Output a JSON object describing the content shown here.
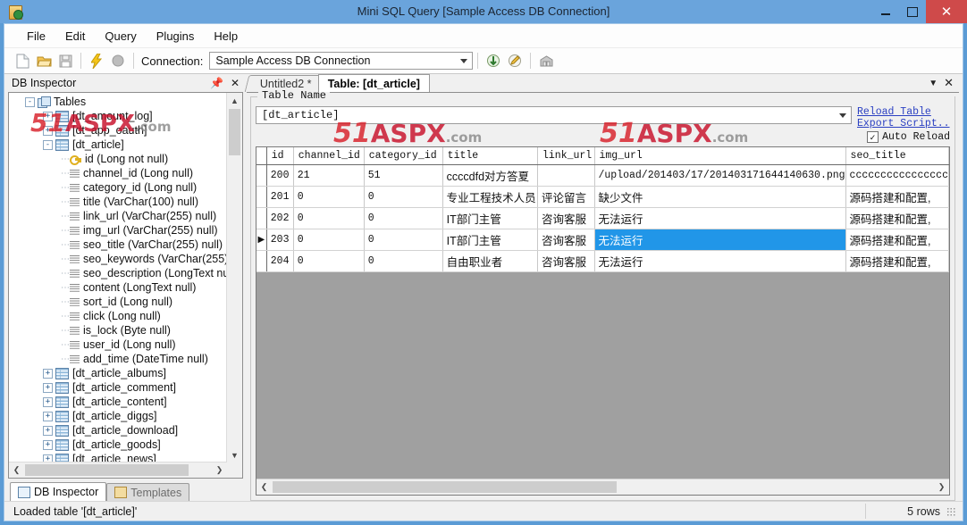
{
  "window": {
    "title": "Mini SQL Query [Sample Access DB Connection]",
    "app_icon": "database-app-icon",
    "minimize": "–",
    "maximize": "□",
    "close": "✕"
  },
  "menubar": {
    "items": [
      {
        "label": "File"
      },
      {
        "label": "Edit"
      },
      {
        "label": "Query"
      },
      {
        "label": "Plugins"
      },
      {
        "label": "Help"
      }
    ]
  },
  "toolbar": {
    "icons": [
      "new-document-icon",
      "open-folder-icon",
      "save-icon",
      "execute-lightning-icon",
      "stop-circle-icon"
    ],
    "connection_label": "Connection:",
    "connection_value": "Sample Access DB Connection",
    "right_icons": [
      "refresh-connection-icon",
      "edit-connection-icon",
      "database-browse-icon"
    ]
  },
  "left_pane": {
    "title": "DB Inspector",
    "pin_icon": "pin-icon",
    "close_icon": "close-icon",
    "tree": [
      {
        "depth": 0,
        "label": "Tables",
        "icon": "tables-folder-icon",
        "expander": "-"
      },
      {
        "depth": 1,
        "label": "[dt_amount_log]",
        "icon": "table-icon",
        "expander": "+"
      },
      {
        "depth": 1,
        "label": "[dt_app_oauth]",
        "icon": "table-icon",
        "expander": "+"
      },
      {
        "depth": 1,
        "label": "[dt_article]",
        "icon": "table-icon",
        "expander": "-"
      },
      {
        "depth": 2,
        "label": "id (Long not null)",
        "icon": "key-icon",
        "expander": ""
      },
      {
        "depth": 2,
        "label": "channel_id (Long null)",
        "icon": "column-icon",
        "expander": ""
      },
      {
        "depth": 2,
        "label": "category_id (Long null)",
        "icon": "column-icon",
        "expander": ""
      },
      {
        "depth": 2,
        "label": "title (VarChar(100) null)",
        "icon": "column-icon",
        "expander": ""
      },
      {
        "depth": 2,
        "label": "link_url (VarChar(255) null)",
        "icon": "column-icon",
        "expander": ""
      },
      {
        "depth": 2,
        "label": "img_url (VarChar(255) null)",
        "icon": "column-icon",
        "expander": ""
      },
      {
        "depth": 2,
        "label": "seo_title (VarChar(255) null)",
        "icon": "column-icon",
        "expander": ""
      },
      {
        "depth": 2,
        "label": "seo_keywords (VarChar(255)",
        "icon": "column-icon",
        "expander": ""
      },
      {
        "depth": 2,
        "label": "seo_description (LongText nu",
        "icon": "column-icon",
        "expander": ""
      },
      {
        "depth": 2,
        "label": "content (LongText null)",
        "icon": "column-icon",
        "expander": ""
      },
      {
        "depth": 2,
        "label": "sort_id (Long null)",
        "icon": "column-icon",
        "expander": ""
      },
      {
        "depth": 2,
        "label": "click (Long null)",
        "icon": "column-icon",
        "expander": ""
      },
      {
        "depth": 2,
        "label": "is_lock (Byte null)",
        "icon": "column-icon",
        "expander": ""
      },
      {
        "depth": 2,
        "label": "user_id (Long null)",
        "icon": "column-icon",
        "expander": ""
      },
      {
        "depth": 2,
        "label": "add_time (DateTime null)",
        "icon": "column-icon",
        "expander": ""
      },
      {
        "depth": 1,
        "label": "[dt_article_albums]",
        "icon": "table-icon",
        "expander": "+"
      },
      {
        "depth": 1,
        "label": "[dt_article_comment]",
        "icon": "table-icon",
        "expander": "+"
      },
      {
        "depth": 1,
        "label": "[dt_article_content]",
        "icon": "table-icon",
        "expander": "+"
      },
      {
        "depth": 1,
        "label": "[dt_article_diggs]",
        "icon": "table-icon",
        "expander": "+"
      },
      {
        "depth": 1,
        "label": "[dt_article_download]",
        "icon": "table-icon",
        "expander": "+"
      },
      {
        "depth": 1,
        "label": "[dt_article_goods]",
        "icon": "table-icon",
        "expander": "+"
      },
      {
        "depth": 1,
        "label": "[dt_article_news]",
        "icon": "table-icon",
        "expander": "+"
      }
    ],
    "bottom_tabs": [
      {
        "label": "DB Inspector",
        "icon": "db-inspector-icon",
        "active": true
      },
      {
        "label": "Templates",
        "icon": "templates-folder-icon",
        "active": false
      }
    ]
  },
  "right_pane": {
    "tabs": [
      {
        "label": "Untitled2 *",
        "active": false
      },
      {
        "label": "Table: [dt_article]",
        "active": true
      }
    ],
    "tab_menu_icon": "chevron-down-icon",
    "tab_close_icon": "close-icon",
    "group_label": "Table Name",
    "table_name_value": "[dt_article]",
    "links": [
      {
        "label": "Reload Table"
      },
      {
        "label": "Export Script.."
      }
    ],
    "auto_reload_label": "Auto Reload",
    "auto_reload_checked": true,
    "grid": {
      "columns": [
        "id",
        "channel_id",
        "category_id",
        "title",
        "link_url",
        "img_url",
        "seo_title"
      ],
      "rows": [
        {
          "indicator": "",
          "cells": [
            "200",
            "21",
            "51",
            "ccccdfd对方答夏",
            "",
            "/upload/201403/17/201403171644140630.png",
            "cccccccccccccccc"
          ],
          "selected_col": -1
        },
        {
          "indicator": "",
          "cells": [
            "201",
            "0",
            "0",
            "专业工程技术人员",
            "评论留言",
            "缺少文件",
            "源码搭建和配置,"
          ],
          "selected_col": -1
        },
        {
          "indicator": "",
          "cells": [
            "202",
            "0",
            "0",
            "IT部门主管",
            "咨询客服",
            "无法运行",
            "源码搭建和配置,"
          ],
          "selected_col": -1
        },
        {
          "indicator": "▶",
          "cells": [
            "203",
            "0",
            "0",
            "IT部门主管",
            "咨询客服",
            "无法运行",
            "源码搭建和配置,"
          ],
          "selected_col": 5
        },
        {
          "indicator": "",
          "cells": [
            "204",
            "0",
            "0",
            "自由职业者",
            "咨询客服",
            "无法运行",
            "源码搭建和配置,"
          ],
          "selected_col": -1
        }
      ]
    }
  },
  "statusbar": {
    "message": "Loaded table '[dt_article]'",
    "row_count": "5 rows"
  },
  "watermark": {
    "num": "51",
    "word": "ASPX",
    "tld": ".com"
  },
  "colors": {
    "titlebar": "#6aa4dc",
    "accent_blue": "#5b9bd5",
    "close_red": "#cf4a4a",
    "selection": "#2196e8",
    "link": "#2a3fc2",
    "grid_empty": "#a0a0a0"
  }
}
